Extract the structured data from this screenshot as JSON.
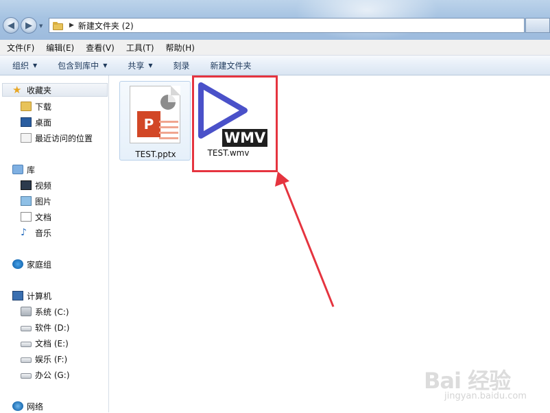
{
  "address_bar": {
    "path": "新建文件夹 (2)"
  },
  "menu": [
    "文件(F)",
    "编辑(E)",
    "查看(V)",
    "工具(T)",
    "帮助(H)"
  ],
  "toolbar": {
    "organize": "组织",
    "include_in_library": "包含到库中",
    "share": "共享",
    "burn": "刻录",
    "new_folder": "新建文件夹"
  },
  "nav": {
    "favorites": {
      "label": "收藏夹",
      "items": [
        "下载",
        "桌面",
        "最近访问的位置"
      ]
    },
    "libraries": {
      "label": "库",
      "items": [
        "视频",
        "图片",
        "文档",
        "音乐"
      ]
    },
    "homegroup": {
      "label": "家庭组"
    },
    "computer": {
      "label": "计算机",
      "items": [
        "系统 (C:)",
        "软件 (D:)",
        "文档 (E:)",
        "娱乐 (F:)",
        "办公 (G:)"
      ]
    },
    "network": {
      "label": "网络"
    }
  },
  "files": [
    {
      "name": "TEST.pptx",
      "icon": "powerpoint-file-icon",
      "badge": "P"
    },
    {
      "name": "TEST.wmv",
      "icon": "wmv-video-file-icon",
      "badge": "WMV"
    }
  ],
  "annotation": {
    "color": "#e5343f"
  },
  "watermark": {
    "logo": "Bai 经验",
    "url": "jingyan.baidu.com"
  }
}
